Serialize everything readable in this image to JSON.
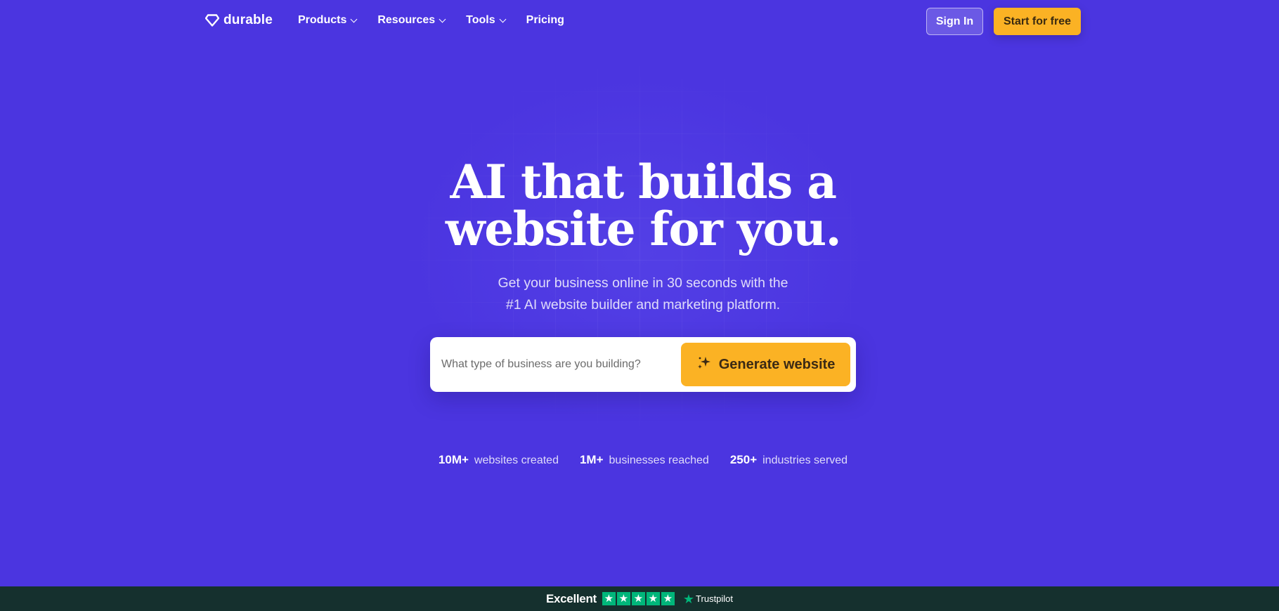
{
  "brand": {
    "name": "durable",
    "logo_icon": "gem-icon"
  },
  "nav": {
    "items": [
      {
        "label": "Products",
        "has_dropdown": true
      },
      {
        "label": "Resources",
        "has_dropdown": true
      },
      {
        "label": "Tools",
        "has_dropdown": true
      },
      {
        "label": "Pricing",
        "has_dropdown": false
      }
    ],
    "sign_in": "Sign In",
    "start": "Start for free"
  },
  "hero": {
    "title_line1": "AI that builds a",
    "title_line2": "website for you.",
    "sub_line1": "Get your business online in 30 seconds with the",
    "sub_line2": "#1 AI website builder and marketing platform.",
    "input_placeholder": "What type of business are you building?",
    "input_value": "",
    "generate_button": "Generate website",
    "generate_icon": "sparkle-icon"
  },
  "stats": [
    {
      "value": "10M+",
      "label": "websites created"
    },
    {
      "value": "1M+",
      "label": "businesses reached"
    },
    {
      "value": "250+",
      "label": "industries served"
    }
  ],
  "trust": {
    "rating_word": "Excellent",
    "stars": 5,
    "provider": "Trustpilot"
  },
  "colors": {
    "background": "#4b35e0",
    "accent": "#fbb224",
    "trust_bar": "#15302e",
    "trustpilot_green": "#00b67a"
  }
}
